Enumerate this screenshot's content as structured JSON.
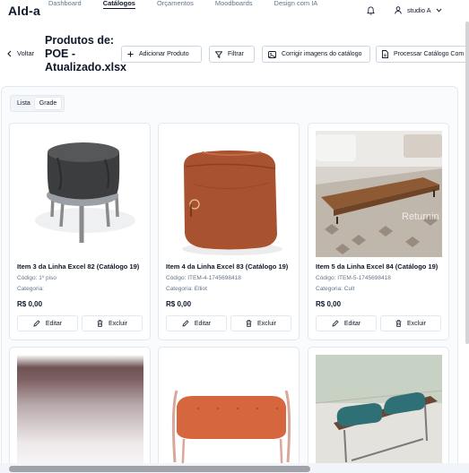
{
  "app": {
    "brand": "Ald-a"
  },
  "nav": {
    "links": [
      "Dashboard",
      "Catálogos",
      "Orçamentos",
      "Moodboards",
      "Design com IA"
    ],
    "active": "Catálogos"
  },
  "user": {
    "name": "studio A"
  },
  "header": {
    "back_label": "Voltar",
    "title": "Produtos de: POE - Atualizado.xlsx",
    "buttons": {
      "add": "Adicionar Produto",
      "filter": "Filtrar",
      "fix_images": "Corrigir imagens do catálogo",
      "process": "Processar Catálogo Com"
    }
  },
  "view_toggle": {
    "list": "Lista",
    "grid": "Grade",
    "selected": "Grade"
  },
  "products": [
    {
      "name": "Item 3 da Linha Excel 82 (Catálogo 19)",
      "code": "Código: 1º piso",
      "category": "Categoria:",
      "price": "R$ 0,00",
      "edit": "Editar",
      "delete": "Excluir"
    },
    {
      "name": "Item 4 da Linha Excel 83 (Catálogo 19)",
      "code": "Código: ITEM-4-1745698418",
      "category": "Categoria: Elliot",
      "price": "R$ 0,00",
      "edit": "Editar",
      "delete": "Excluir"
    },
    {
      "name": "Item 5 da Linha Excel 84 (Catálogo 19)",
      "code": "Código: ITEM-5-1745698418",
      "category": "Categoria: Cult",
      "price": "R$ 0,00",
      "edit": "Editar",
      "delete": "Excluir"
    }
  ],
  "image_watermark": "Returnin",
  "colors": {
    "accent": "#0f172a",
    "muted": "#64748b",
    "border": "#e2e8f0"
  }
}
